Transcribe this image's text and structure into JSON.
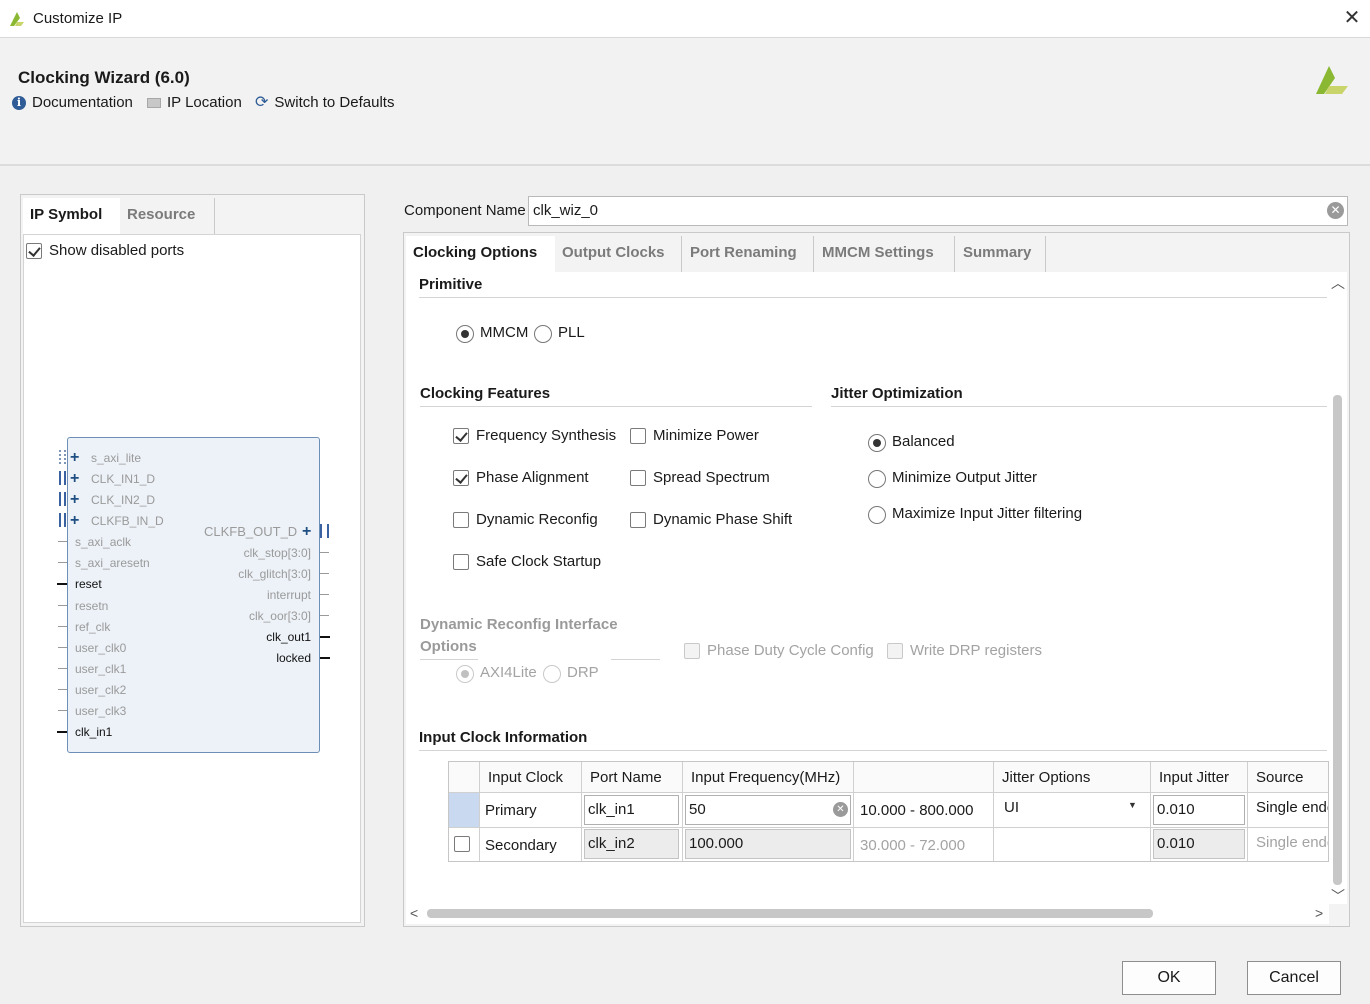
{
  "window": {
    "title": "Customize IP"
  },
  "header": {
    "title": "Clocking Wizard (6.0)",
    "toolbar": {
      "documentation": "Documentation",
      "ip_location": "IP Location",
      "switch_defaults": "Switch to Defaults"
    }
  },
  "left": {
    "tabs": [
      "IP Symbol",
      "Resource"
    ],
    "show_disabled": "Show disabled ports",
    "symbol": {
      "left_ports": [
        "s_axi_lite",
        "CLK_IN1_D",
        "CLK_IN2_D",
        "CLKFB_IN_D",
        "s_axi_aclk",
        "s_axi_aresetn",
        "reset",
        "resetn",
        "ref_clk",
        "user_clk0",
        "user_clk1",
        "user_clk2",
        "user_clk3",
        "clk_in1"
      ],
      "right_ports": [
        "CLKFB_OUT_D",
        "clk_stop[3:0]",
        "clk_glitch[3:0]",
        "interrupt",
        "clk_oor[3:0]",
        "clk_out1",
        "locked"
      ]
    }
  },
  "right": {
    "component_name_label": "Component Name",
    "component_name": "clk_wiz_0",
    "tabs": [
      "Clocking Options",
      "Output Clocks",
      "Port Renaming",
      "MMCM Settings",
      "Summary"
    ],
    "primitive": {
      "title": "Primitive",
      "options": [
        "MMCM",
        "PLL"
      ]
    },
    "clocking_features": {
      "title": "Clocking Features",
      "items": [
        "Frequency Synthesis",
        "Minimize Power",
        "Phase Alignment",
        "Spread Spectrum",
        "Dynamic Reconfig",
        "Dynamic Phase Shift",
        "Safe Clock Startup"
      ]
    },
    "jitter_optimization": {
      "title": "Jitter Optimization",
      "options": [
        "Balanced",
        "Minimize Output Jitter",
        "Maximize Input Jitter filtering"
      ]
    },
    "dynamic_reconfig": {
      "title_line1": "Dynamic Reconfig Interface",
      "title_line2": "Options",
      "options": [
        "AXI4Lite",
        "DRP"
      ],
      "checks": [
        "Phase Duty Cycle Config",
        "Write DRP registers"
      ]
    },
    "input_clock": {
      "title": "Input Clock Information",
      "headers": [
        "Input Clock",
        "Port Name",
        "Input Frequency(MHz)",
        "",
        "Jitter Options",
        "Input Jitter",
        "Source"
      ],
      "rows": [
        {
          "input_clock": "Primary",
          "port": "clk_in1",
          "freq": "50",
          "range": "10.000 - 800.000",
          "jitter_opt": "UI",
          "jitter": "0.010",
          "source": "Single ended"
        },
        {
          "input_clock": "Secondary",
          "port": "clk_in2",
          "freq": "100.000",
          "range": "30.000 - 72.000",
          "jitter_opt": "",
          "jitter": "0.010",
          "source": "Single ended"
        }
      ]
    }
  },
  "buttons": {
    "ok": "OK",
    "cancel": "Cancel"
  },
  "colors": {
    "accent": "#2f5c96",
    "logo": "#8ab833",
    "symbol_border": "#6d8fb5"
  }
}
